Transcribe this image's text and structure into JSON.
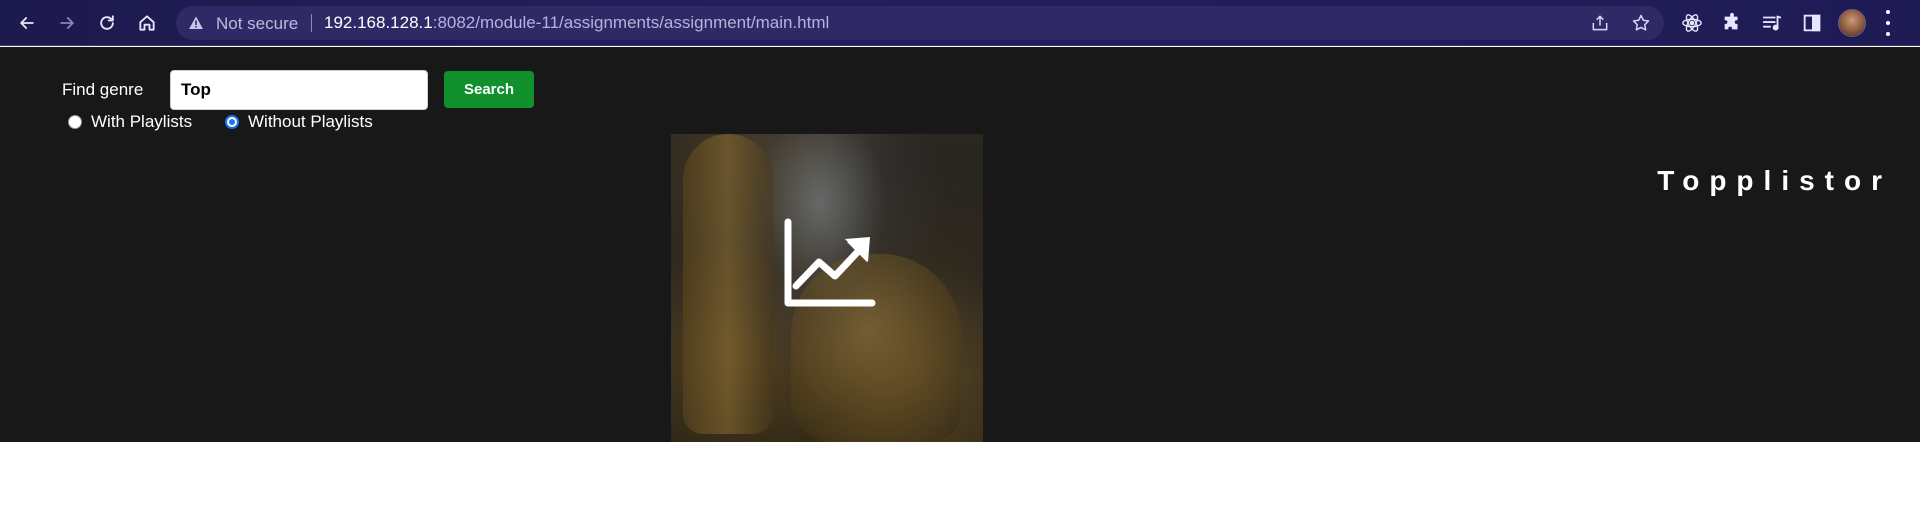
{
  "browser": {
    "security_label": "Not secure",
    "url_host": "192.168.128.1",
    "url_path": ":8082/module-11/assignments/assignment/main.html",
    "icons": [
      "back-icon",
      "forward-icon",
      "reload-icon",
      "home-icon",
      "warning-icon",
      "share-icon",
      "star-icon",
      "react-devtools-icon",
      "extensions-icon",
      "media-icon",
      "side-panel-icon",
      "avatar",
      "menu-icon"
    ]
  },
  "search": {
    "label": "Find genre",
    "value": "Top",
    "button_label": "Search",
    "options": [
      {
        "label": "With Playlists",
        "checked": false
      },
      {
        "label": "Without Playlists",
        "checked": true
      }
    ]
  },
  "hero": {
    "title": "Topplistor",
    "cover_icon": "trending-up-icon"
  },
  "colors": {
    "hero_bg": "#181818",
    "search_button": "#11902e",
    "radio_accent": "#1a73e8"
  }
}
